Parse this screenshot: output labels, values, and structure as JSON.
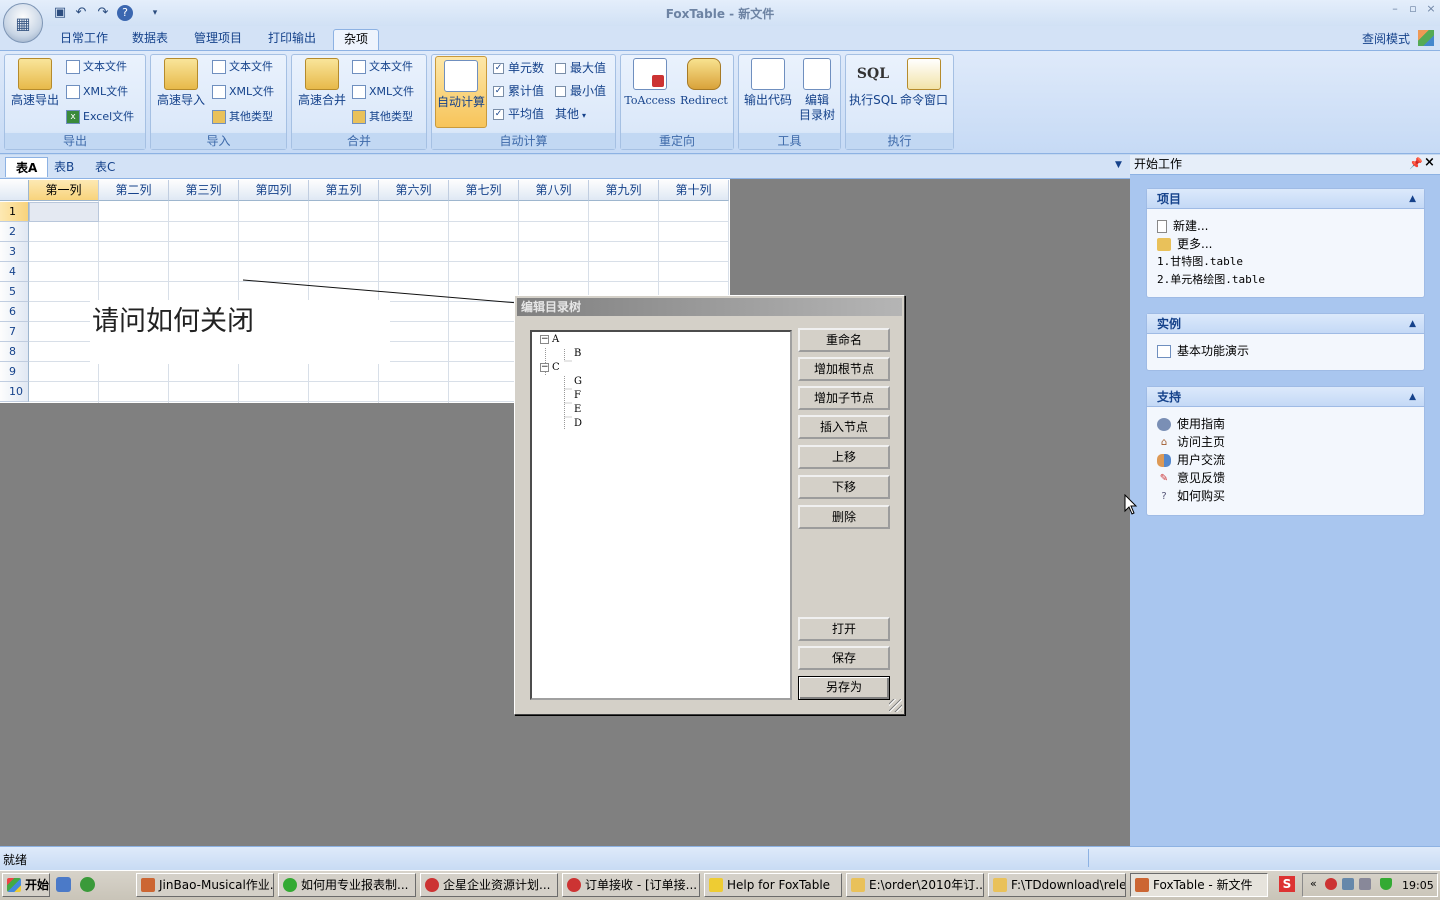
{
  "app": {
    "title": "FoxTable - 新文件",
    "view_mode": "查阅模式",
    "status": "就绪"
  },
  "ribbon": {
    "tabs": [
      "日常工作",
      "数据表",
      "管理项目",
      "打印输出",
      "杂项"
    ],
    "active_tab": "杂项",
    "groups": {
      "export": {
        "caption": "导出",
        "big": "高速导出",
        "items": [
          "文本文件",
          "XML文件",
          "Excel文件"
        ]
      },
      "import": {
        "caption": "导入",
        "big": "高速导入",
        "items": [
          "文本文件",
          "XML文件",
          "其他类型"
        ]
      },
      "merge": {
        "caption": "合并",
        "big": "高速合并",
        "items": [
          "文本文件",
          "XML文件",
          "其他类型"
        ]
      },
      "autocalc": {
        "caption": "自动计算",
        "big": "自动计算",
        "checks": [
          {
            "label": "单元数",
            "checked": true
          },
          {
            "label": "累计值",
            "checked": true
          },
          {
            "label": "平均值",
            "checked": true
          },
          {
            "label": "最大值",
            "checked": false
          },
          {
            "label": "最小值",
            "checked": false
          }
        ],
        "other": "其他"
      },
      "redirect": {
        "caption": "重定向",
        "buttons": [
          "ToAccess",
          "Redirect"
        ]
      },
      "tools": {
        "caption": "工具",
        "buttons": [
          "输出代码",
          "编辑\n目录树"
        ],
        "btn2_line1": "编辑",
        "btn2_line2": "目录树"
      },
      "exec": {
        "caption": "执行",
        "buttons": [
          "执行SQL",
          "命令窗口"
        ]
      }
    }
  },
  "sheets": {
    "tabs": [
      "表A",
      "表B",
      "表C"
    ],
    "active": "表A"
  },
  "grid": {
    "columns": [
      "第一列",
      "第二列",
      "第三列",
      "第四列",
      "第五列",
      "第六列",
      "第七列",
      "第八列",
      "第九列",
      "第十列"
    ],
    "rows": [
      "1",
      "2",
      "3",
      "4",
      "5",
      "6",
      "7",
      "8",
      "9",
      "10"
    ]
  },
  "annotation": {
    "text": "请问如何关闭"
  },
  "dialog": {
    "title": "编辑目录树",
    "tree": [
      "A",
      "B",
      "C",
      "G",
      "F",
      "E",
      "D"
    ],
    "buttons": [
      "重命名",
      "增加根节点",
      "增加子节点",
      "插入节点",
      "上移",
      "下移",
      "删除",
      "打开",
      "保存",
      "另存为"
    ]
  },
  "right_panel": {
    "title": "开始工作",
    "sections": [
      {
        "title": "项目",
        "items": [
          "新建...",
          "更多...",
          "1.甘特图.table",
          "2.单元格绘图.table"
        ]
      },
      {
        "title": "实例",
        "items": [
          "基本功能演示"
        ]
      },
      {
        "title": "支持",
        "items": [
          "使用指南",
          "访问主页",
          "用户交流",
          "意见反馈",
          "如何购买"
        ]
      }
    ]
  },
  "taskbar": {
    "start": "开始",
    "items": [
      "JinBao-Musical作业...",
      "如何用专业报表制...",
      "企星企业资源计划...",
      "订单接收 - [订单接...",
      "Help for FoxTable",
      "E:\\order\\2010年订...",
      "F:\\TDdownload\\rele...",
      "FoxTable - 新文件"
    ],
    "clock": "19:05"
  },
  "colors": {
    "accent": "#15428b",
    "ribbon_bg": "#c6daf5",
    "workspace": "#808080",
    "dialog_bg": "#d4d0c8"
  }
}
